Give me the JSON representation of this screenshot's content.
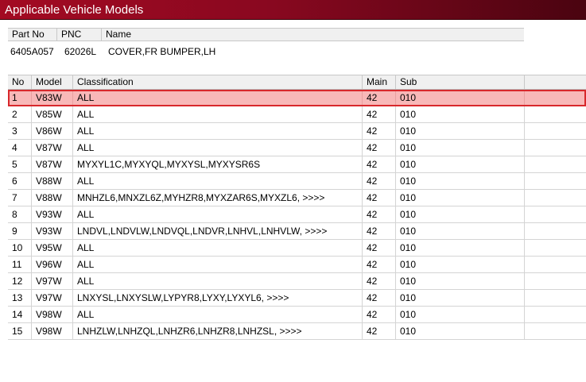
{
  "window": {
    "title": "Applicable Vehicle Models"
  },
  "part_info": {
    "headers": [
      "Part No",
      "PNC",
      "Name"
    ],
    "part_no": "6405A057",
    "pnc": "62026L",
    "name": "COVER,FR BUMPER,LH"
  },
  "models_table": {
    "headers": [
      "No",
      "Model",
      "Classification",
      "Main",
      "Sub"
    ],
    "selected_row": 0,
    "rows": [
      [
        "1",
        "V83W",
        "ALL",
        "42",
        "010"
      ],
      [
        "2",
        "V85W",
        "ALL",
        "42",
        "010"
      ],
      [
        "3",
        "V86W",
        "ALL",
        "42",
        "010"
      ],
      [
        "4",
        "V87W",
        "ALL",
        "42",
        "010"
      ],
      [
        "5",
        "V87W",
        "MYXYL1C,MYXYQL,MYXYSL,MYXYSR6S",
        "42",
        "010"
      ],
      [
        "6",
        "V88W",
        "ALL",
        "42",
        "010"
      ],
      [
        "7",
        "V88W",
        "MNHZL6,MNXZL6Z,MYHZR8,MYXZAR6S,MYXZL6,  >>>>",
        "42",
        "010"
      ],
      [
        "8",
        "V93W",
        "ALL",
        "42",
        "010"
      ],
      [
        "9",
        "V93W",
        "LNDVL,LNDVLW,LNDVQL,LNDVR,LNHVL,LNHVLW,  >>>>",
        "42",
        "010"
      ],
      [
        "10",
        "V95W",
        "ALL",
        "42",
        "010"
      ],
      [
        "11",
        "V96W",
        "ALL",
        "42",
        "010"
      ],
      [
        "12",
        "V97W",
        "ALL",
        "42",
        "010"
      ],
      [
        "13",
        "V97W",
        "LNXYSL,LNXYSLW,LYPYR8,LYXY,LYXYL6,  >>>>",
        "42",
        "010"
      ],
      [
        "14",
        "V98W",
        "ALL",
        "42",
        "010"
      ],
      [
        "15",
        "V98W",
        "LNHZLW,LNHZQL,LNHZR6,LNHZR8,LNHZSL,  >>>>",
        "42",
        "010"
      ]
    ]
  }
}
